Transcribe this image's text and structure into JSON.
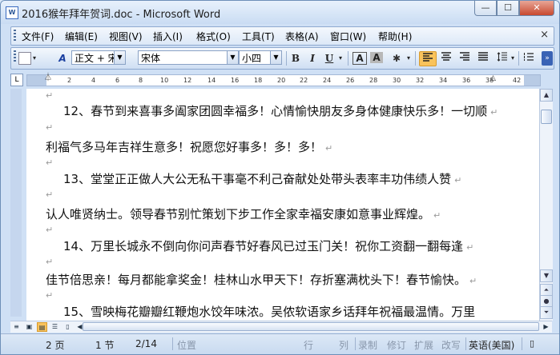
{
  "window": {
    "title": "2016猴年拜年贺词.doc - Microsoft Word",
    "app_icon": "word-doc-icon",
    "controls": {
      "minimize": "—",
      "maximize": "☐",
      "close": "✕"
    }
  },
  "menubar": {
    "items": [
      "文件(F)",
      "编辑(E)",
      "视图(V)",
      "插入(I)",
      "格式(O)",
      "工具(T)",
      "表格(A)",
      "窗口(W)",
      "帮助(H)"
    ],
    "close_glyph": "×"
  },
  "toolbar": {
    "style_value": "正文 + 宋体",
    "font_value": "宋体",
    "size_value": "小四",
    "bold": "B",
    "italic": "I",
    "underline": "U",
    "char_border": "A",
    "char_shade": "A",
    "active_align": "align-left"
  },
  "ruler": {
    "numbers": [
      "2",
      "4",
      "6",
      "8",
      "10",
      "12",
      "14",
      "16",
      "18",
      "20",
      "22",
      "24",
      "26",
      "28",
      "30",
      "32",
      "34",
      "36",
      "38",
      "42"
    ],
    "tab_button": "L"
  },
  "document": {
    "lines": [
      {
        "text": "12、春节到来喜事多阖家团圆幸福多！心情愉快朋友多身体健康快乐多！一切顺",
        "indent": true
      },
      {
        "text": "利福气多马年吉祥生意多！祝愿您好事多！多！多！",
        "indent": false
      },
      {
        "text": "13、堂堂正正做人大公无私干事毫不利己奋献处处带头表率丰功伟绩人赞",
        "indent": true
      },
      {
        "text": "认人唯贤纳士。领导春节别忙策划下步工作全家幸福安康如意事业辉煌。",
        "indent": false
      },
      {
        "text": "14、万里长城永不倒向你问声春节好春风已过玉门关！祝你工资翻一翻每逢",
        "indent": true
      },
      {
        "text": "佳节倍思亲！每月都能拿奖金！桂林山水甲天下！存折塞满枕头下！春节愉快。",
        "indent": false
      },
      {
        "text": "15、雪映梅花瓣瓣红鞭炮水饺年味浓。吴侬软语家乡话拜年祝福最温情。万里",
        "indent": true
      }
    ],
    "paragraph_mark": "↵"
  },
  "statusbar": {
    "page": "2 页",
    "section": "1 节",
    "page_of": "2/14",
    "position": "位置",
    "line": "行",
    "column": "列",
    "rec": "录制",
    "trk": "修订",
    "ext": "扩展",
    "ovr": "改写",
    "language": "英语(美国)"
  }
}
